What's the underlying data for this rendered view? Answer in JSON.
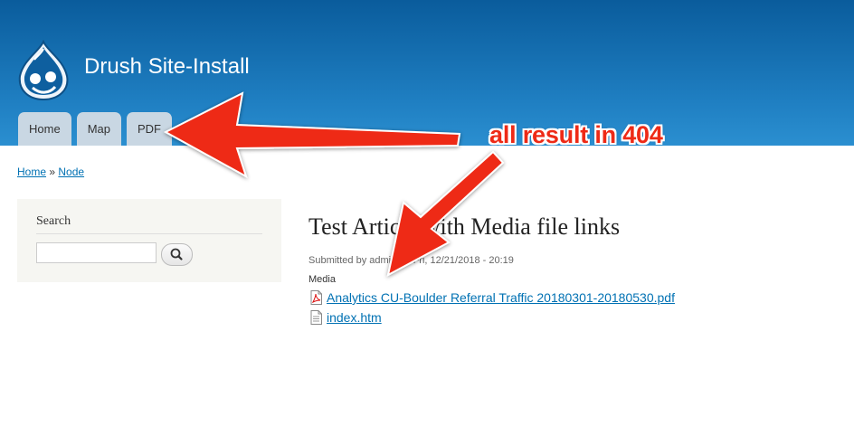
{
  "site": {
    "name": "Drush Site-Install",
    "logo_icon": "drupal-drop-logo"
  },
  "tabs": [
    {
      "label": "Home"
    },
    {
      "label": "Map"
    },
    {
      "label": "PDF"
    }
  ],
  "breadcrumb": {
    "home": "Home",
    "separator": "»",
    "node": "Node"
  },
  "search": {
    "title": "Search",
    "value": "",
    "button_icon": "magnifier-icon"
  },
  "article": {
    "title": "Test Article with Media file links",
    "submitted": "Submitted by admin on Fri, 12/21/2018 - 20:19",
    "media_label": "Media",
    "files": [
      {
        "name": "Analytics CU-Boulder Referral Traffic 20180301-20180530.pdf",
        "icon": "pdf-file-icon"
      },
      {
        "name": "index.htm",
        "icon": "text-file-icon"
      }
    ]
  },
  "annotation": {
    "text": "all result in 404",
    "color": "#ee2a16"
  },
  "colors": {
    "header": "#1a6fb0",
    "link": "#0071b3",
    "tab": "#c9d7e3"
  }
}
